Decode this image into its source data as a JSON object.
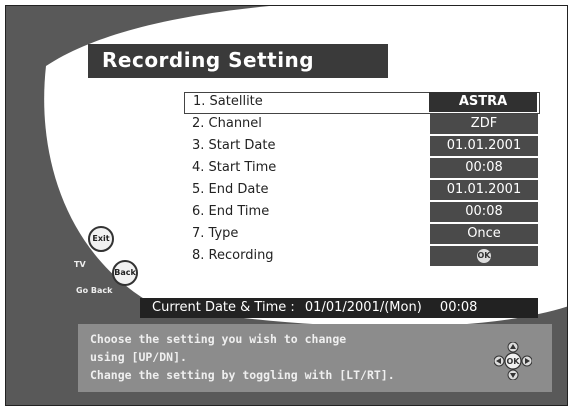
{
  "screen": {
    "title": "Recording Setting",
    "colors": {
      "background": "#595959",
      "panel": "#ffffff",
      "value_box": "#4a4a4a",
      "status_bar": "#222222",
      "help_box": "#8c8c8c"
    }
  },
  "menu": {
    "items": [
      {
        "label": "1. Satellite",
        "value": "ASTRA",
        "selected": true
      },
      {
        "label": "2. Channel",
        "value": "ZDF"
      },
      {
        "label": "3. Start Date",
        "value": "01.01.2001"
      },
      {
        "label": "4. Start Time",
        "value": "00:08"
      },
      {
        "label": "5. End Date",
        "value": "01.01.2001"
      },
      {
        "label": "6. End Time",
        "value": "00:08"
      },
      {
        "label": "7. Type",
        "value": "Once"
      },
      {
        "label": "8. Recording",
        "value": "OK",
        "icon": "ok-button-icon"
      }
    ]
  },
  "side": {
    "exit_label": "Exit",
    "tv_label": "TV",
    "back_label": "Back",
    "go_back_label": "Go Back"
  },
  "status": {
    "label": "Current Date & Time :",
    "datetime": "01/01/2001/(Mon)",
    "time": "00:08"
  },
  "help": {
    "line1": "Choose the setting you wish to change",
    "line2": "using [UP/DN].",
    "line3": "Change the setting by toggling with [LT/RT]."
  },
  "nav_pad": {
    "center_label": "OK",
    "icon": "navigation-pad-icon"
  }
}
